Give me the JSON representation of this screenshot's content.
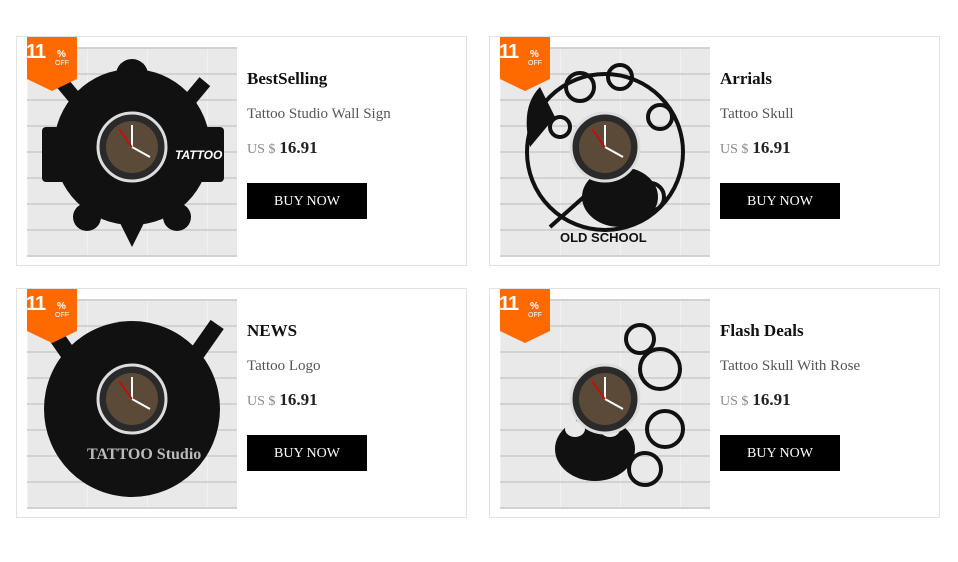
{
  "products": [
    {
      "category": "BestSelling",
      "name": "Tattoo Studio Wall Sign",
      "currency": "US $",
      "price": "16.91",
      "button": "BUY NOW",
      "discount": {
        "number": "11",
        "percent": "%",
        "off": "OFF"
      },
      "clock_text": "TATTOO"
    },
    {
      "category": "Arrials",
      "name": "Tattoo Skull",
      "currency": "US $",
      "price": "16.91",
      "button": "BUY NOW",
      "discount": {
        "number": "11",
        "percent": "%",
        "off": "OFF"
      },
      "clock_text": "OLD SCHOOL"
    },
    {
      "category": "NEWS",
      "name": "Tattoo Logo",
      "currency": "US $",
      "price": "16.91",
      "button": "BUY NOW",
      "discount": {
        "number": "11",
        "percent": "%",
        "off": "OFF"
      },
      "clock_text": "TATTOO Studio"
    },
    {
      "category": "Flash Deals",
      "name": "Tattoo Skull With Rose",
      "currency": "US $",
      "price": "16.91",
      "button": "BUY NOW",
      "discount": {
        "number": "11",
        "percent": "%",
        "off": "OFF"
      },
      "clock_text": ""
    }
  ],
  "colors": {
    "badge": "#ff6a00",
    "button": "#000000",
    "border": "#e2e2e2"
  }
}
